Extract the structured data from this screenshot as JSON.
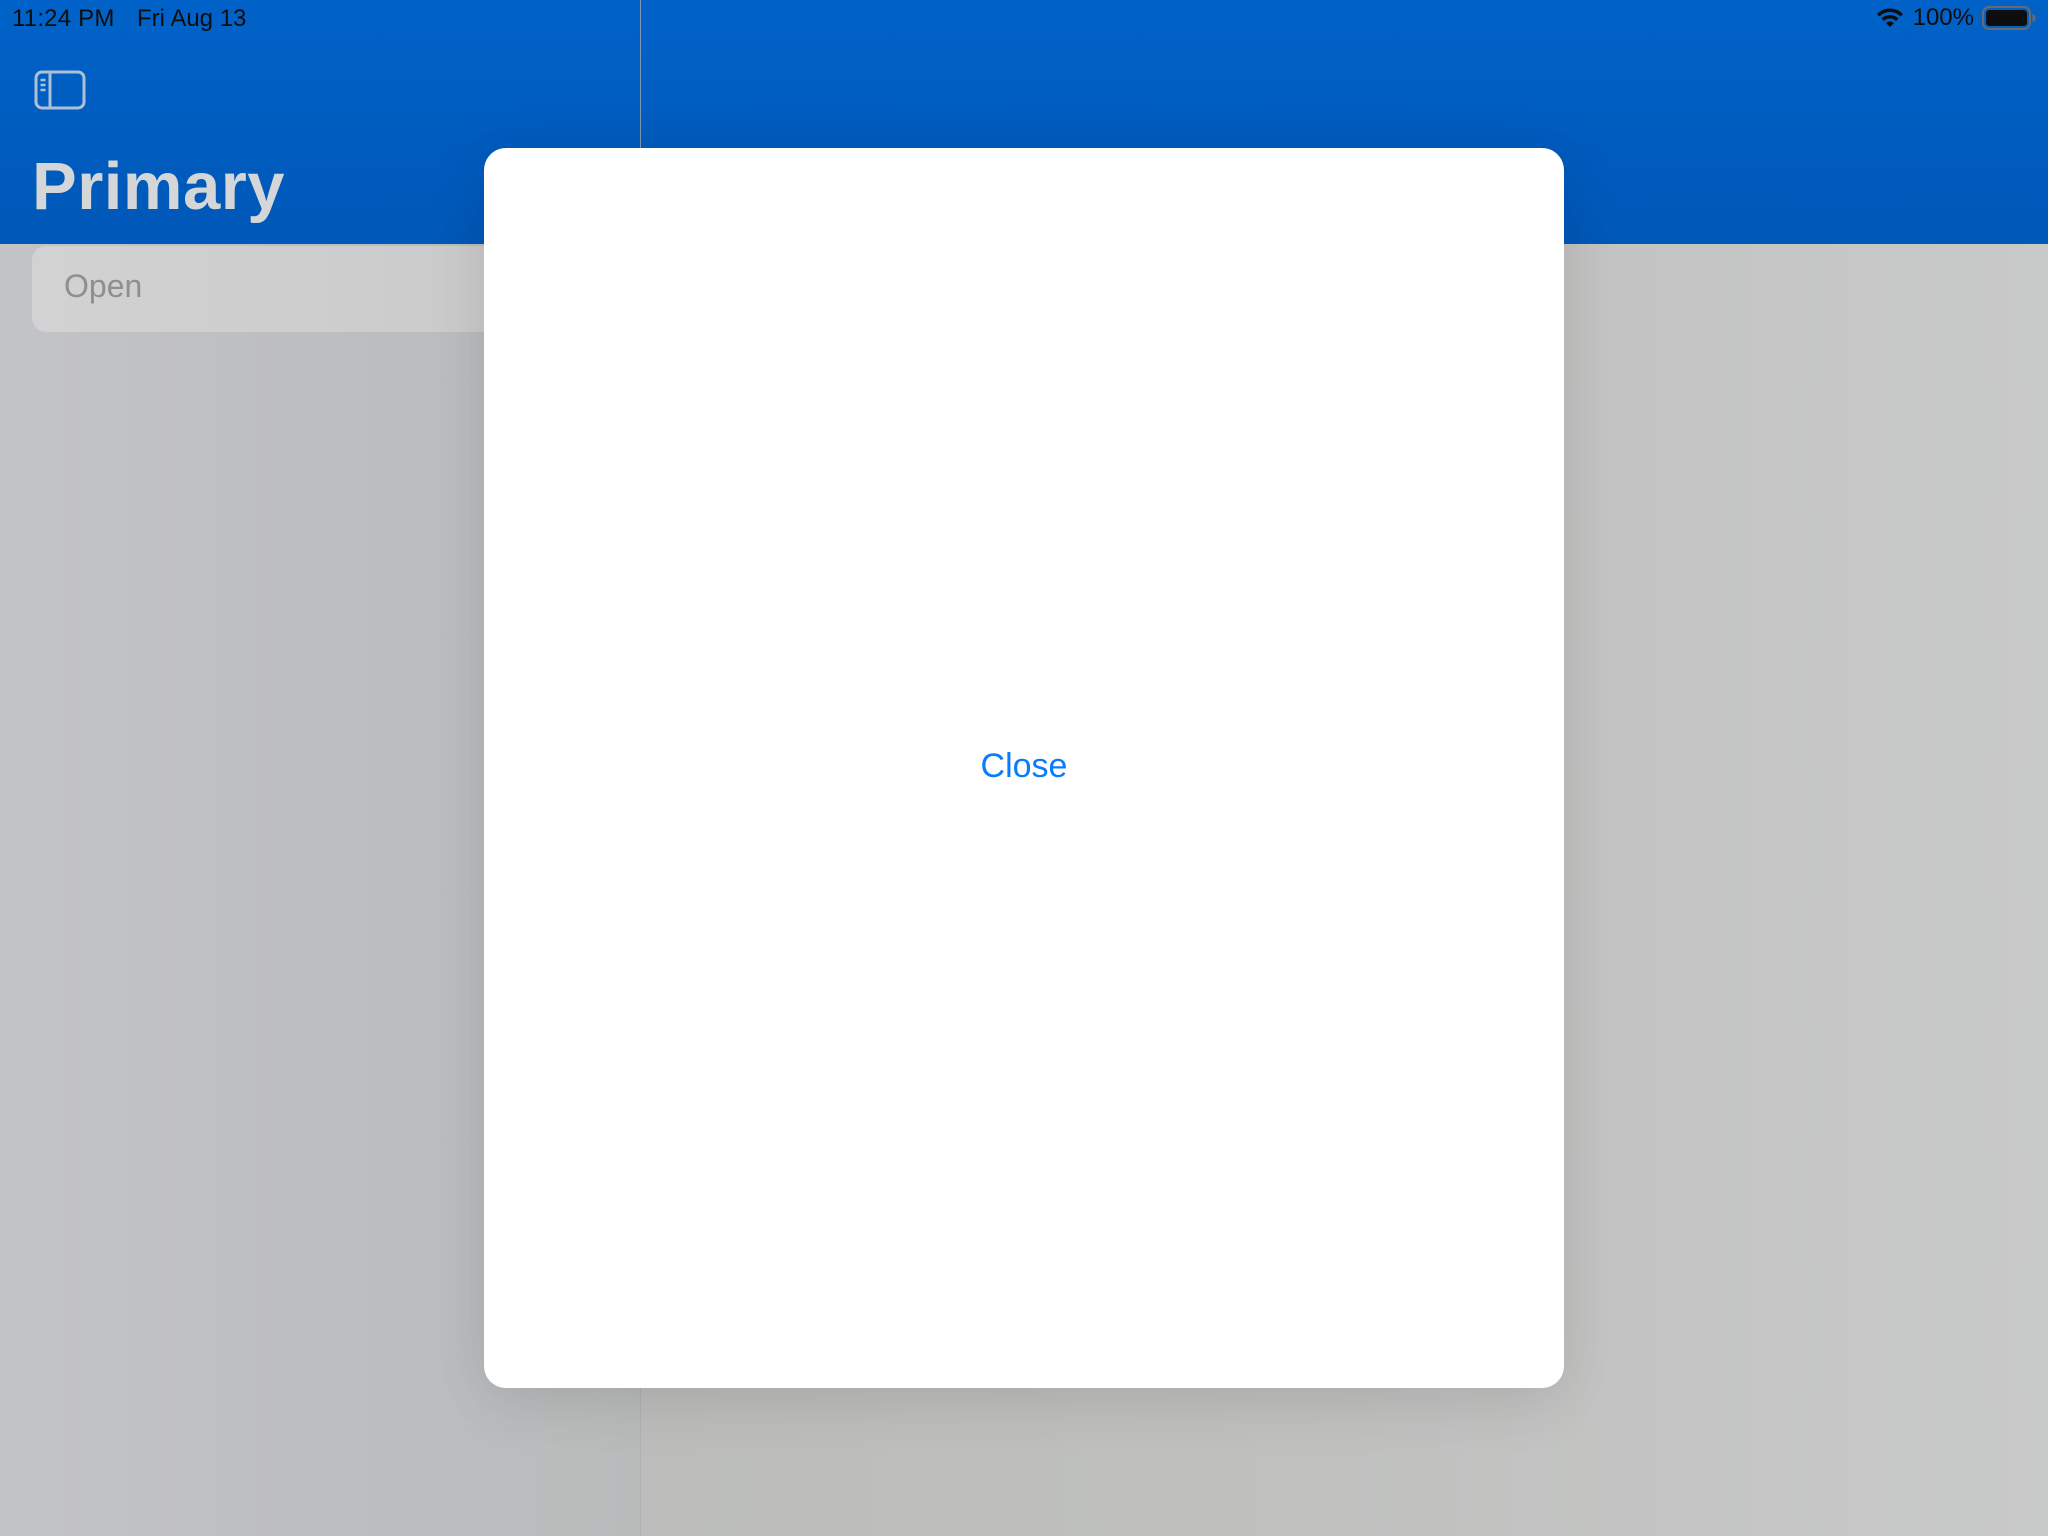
{
  "status_bar": {
    "time": "11:24 PM",
    "date": "Fri Aug 13",
    "battery_percent": "100%",
    "wifi_icon": "wifi-icon",
    "battery_icon": "battery-icon"
  },
  "sidebar": {
    "toggle_icon": "sidebar-icon",
    "title": "Primary",
    "items": [
      {
        "label": "Open"
      }
    ]
  },
  "modal": {
    "close_label": "Close"
  },
  "colors": {
    "header_blue": "#0062c8",
    "accent_link": "#0a7aff",
    "dim_background": "#c7c8c8"
  }
}
